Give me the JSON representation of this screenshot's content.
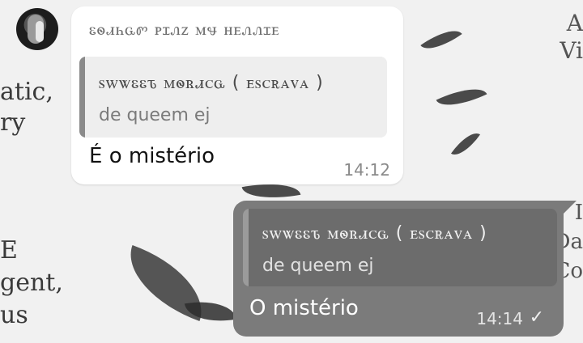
{
  "wallpaper": {
    "left_text_1": "atic,\nry",
    "left_text_2": "E\ngent,\nus",
    "right_text_1": "A\nVi",
    "right_text_2": "I\nDa\nCo"
  },
  "incoming": {
    "sender": "ꮛꮻꮧꮒꮹꮫ ꮲꮖꮑꮓ ꮇꮰ ꮋꭼꮑꮑꮖꭼ",
    "reply_author": "ꮪꮃꮤꮛꮛꮦ ꮇꮻꮢꮧꮯꮹ ( ꭼꮪꮯꭱꭺꮩꭺ )",
    "reply_text": "de queem ej",
    "message": "É o mistério",
    "time": "14:12"
  },
  "outgoing": {
    "reply_author": "ꮪꮃꮤꮛꮛꮦ ꮇꮻꮢꮧꮯꮹ ( ꭼꮪꮯꭱꭺꮩꭺ )",
    "reply_text": "de queem ej",
    "message": "O mistério",
    "time": "14:14",
    "status_icon": "check-icon"
  },
  "colors": {
    "incoming_bubble": "#ffffff",
    "outgoing_bubble": "#7b7b7b",
    "quote_in_bg": "#eeeeee",
    "quote_out_bg": "#6c6c6c"
  }
}
